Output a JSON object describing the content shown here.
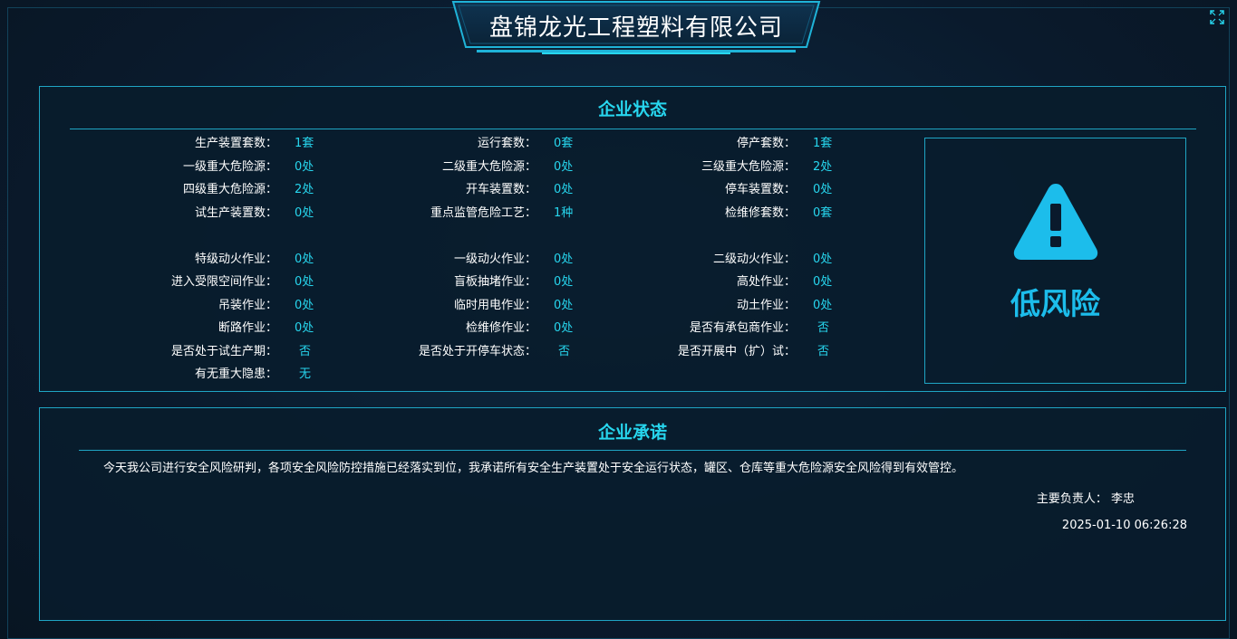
{
  "company_title": "盘锦龙光工程塑料有限公司",
  "status_panel": {
    "title": "企业状态",
    "rows": [
      [
        {
          "label": "生产装置套数：",
          "value": "1套"
        },
        {
          "label": "运行套数：",
          "value": "0套"
        },
        {
          "label": "停产套数：",
          "value": "1套"
        }
      ],
      [
        {
          "label": "一级重大危险源：",
          "value": "0处"
        },
        {
          "label": "二级重大危险源：",
          "value": "0处"
        },
        {
          "label": "三级重大危险源：",
          "value": "2处"
        }
      ],
      [
        {
          "label": "四级重大危险源：",
          "value": "2处"
        },
        {
          "label": "开车装置数：",
          "value": "0处"
        },
        {
          "label": "停车装置数：",
          "value": "0处"
        }
      ],
      [
        {
          "label": "试生产装置数：",
          "value": "0处"
        },
        {
          "label": "重点监管危险工艺：",
          "value": "1种"
        },
        {
          "label": "检维修套数：",
          "value": "0套"
        }
      ],
      [
        {
          "label": "特级动火作业：",
          "value": "0处"
        },
        {
          "label": "一级动火作业：",
          "value": "0处"
        },
        {
          "label": "二级动火作业：",
          "value": "0处"
        }
      ],
      [
        {
          "label": "进入受限空间作业：",
          "value": "0处"
        },
        {
          "label": "盲板抽堵作业：",
          "value": "0处"
        },
        {
          "label": "高处作业：",
          "value": "0处"
        }
      ],
      [
        {
          "label": "吊装作业：",
          "value": "0处"
        },
        {
          "label": "临时用电作业：",
          "value": "0处"
        },
        {
          "label": "动土作业：",
          "value": "0处"
        }
      ],
      [
        {
          "label": "断路作业：",
          "value": "0处"
        },
        {
          "label": "检维修作业：",
          "value": "0处"
        },
        {
          "label": "是否有承包商作业：",
          "value": "否"
        }
      ],
      [
        {
          "label": "是否处于试生产期：",
          "value": "否"
        },
        {
          "label": "是否处于开停车状态：",
          "value": "否"
        },
        {
          "label": "是否开展中（扩）试：",
          "value": "否"
        }
      ],
      [
        {
          "label": "有无重大隐患：",
          "value": "无"
        }
      ]
    ],
    "risk_level": "低风险",
    "risk_icon": "warning-triangle-icon",
    "risk_color": "#1cbdeb"
  },
  "promise_panel": {
    "title": "企业承诺",
    "text": "今天我公司进行安全风险研判，各项安全风险防控措施已经落实到位，我承诺所有安全生产装置处于安全运行状态，罐区、仓库等重大危险源安全风险得到有效管控。",
    "person_label": "主要负责人：",
    "person_name": "李忠",
    "datetime": "2025-01-10 06:26:28"
  },
  "colors": {
    "accent": "#27d6ee",
    "border": "#1fa5c4",
    "background": "#0a1a2c"
  }
}
